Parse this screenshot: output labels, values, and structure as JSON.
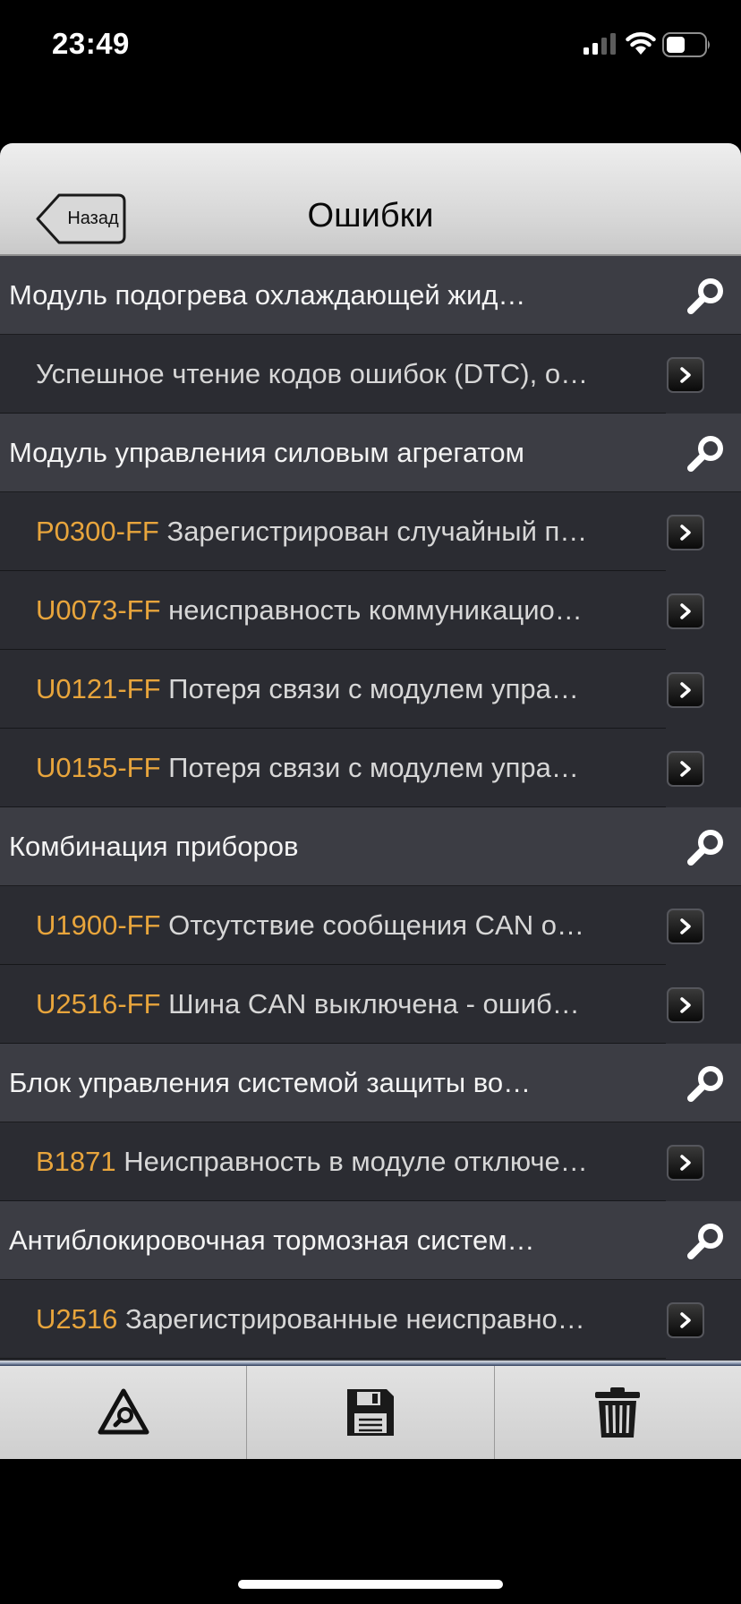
{
  "status_bar": {
    "time": "23:49"
  },
  "nav": {
    "back_label": "Назад",
    "title": "Ошибки"
  },
  "sections": [
    {
      "title": "Модуль подогрева охлаждающей жид…",
      "items": [
        {
          "code": "",
          "description": "Успешное чтение кодов ошибок (DTC), о…"
        }
      ]
    },
    {
      "title": "Модуль управления силовым агрегатом",
      "items": [
        {
          "code": "P0300-FF",
          "description": "Зарегистрирован случайный п…"
        },
        {
          "code": "U0073-FF",
          "description": "неисправность коммуникацио…"
        },
        {
          "code": "U0121-FF",
          "description": "Потеря связи с модулем упра…"
        },
        {
          "code": "U0155-FF",
          "description": "Потеря связи с модулем упра…"
        }
      ]
    },
    {
      "title": "Комбинация приборов",
      "items": [
        {
          "code": "U1900-FF",
          "description": "Отсутствие сообщения CAN о…"
        },
        {
          "code": "U2516-FF",
          "description": "Шина CAN выключена - ошиб…"
        }
      ]
    },
    {
      "title": "Блок управления системой защиты во…",
      "items": [
        {
          "code": "B1871",
          "description": "Неисправность в модуле отключе…"
        }
      ]
    },
    {
      "title": "Антиблокировочная тормозная систем…",
      "items": [
        {
          "code": "U2516",
          "description": "Зарегистрированные неисправно…"
        }
      ]
    }
  ],
  "toolbar": {
    "icons": [
      "search-warning-icon",
      "save-icon",
      "trash-icon"
    ]
  },
  "colors": {
    "code": "#e8a53c",
    "section_bg": "#3c3d44",
    "item_bg": "#2b2c32"
  }
}
